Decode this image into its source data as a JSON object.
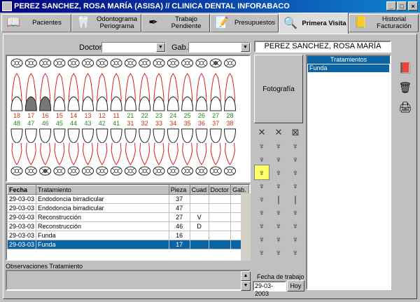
{
  "window": {
    "title": "PEREZ SANCHEZ, ROSA MARÍA (ASISA) // CLINICA DENTAL INFORABACO"
  },
  "tabs": [
    {
      "label": "Pacientes",
      "icon": "book-icon"
    },
    {
      "label": "Odontograma Periograma",
      "icon": "teeth-icon"
    },
    {
      "label": "Trabajo Pendiente",
      "icon": "pen-icon"
    },
    {
      "label": "Presupuestos",
      "icon": "document-pen-icon"
    },
    {
      "label": "Primera Visita",
      "icon": "magnifier-icon",
      "active": true
    },
    {
      "label": "Historial Facturación",
      "icon": "notepad-icon"
    }
  ],
  "filters": {
    "doctor_label": "Doctor",
    "doctor_value": "",
    "gab_label": "Gab.",
    "gab_value": "",
    "patient_name": "PEREZ SANCHEZ, ROSA MARÍA"
  },
  "odontogram": {
    "upper_numbers": [
      "18",
      "17",
      "16",
      "15",
      "14",
      "13",
      "12",
      "11",
      "21",
      "22",
      "23",
      "24",
      "25",
      "26",
      "27",
      "28"
    ],
    "lower_numbers": [
      "48",
      "47",
      "46",
      "45",
      "44",
      "43",
      "42",
      "41",
      "31",
      "32",
      "33",
      "34",
      "35",
      "36",
      "37",
      "38"
    ]
  },
  "photo_button": "Fotografía",
  "treatments_panel": {
    "header": "Tratamientos",
    "items": [
      "Funda"
    ]
  },
  "table": {
    "columns": [
      "Fecha",
      "Tratamiento",
      "Pieza",
      "Cuad",
      "Doctor",
      "Gab."
    ],
    "rows": [
      {
        "fecha": "29-03-03",
        "tratamiento": "Endodoncia birradicular",
        "pieza": "37",
        "cuad": "",
        "doctor": "",
        "gab": ""
      },
      {
        "fecha": "29-03-03",
        "tratamiento": "Endodoncia birradicular",
        "pieza": "47",
        "cuad": "",
        "doctor": "",
        "gab": ""
      },
      {
        "fecha": "29-03-03",
        "tratamiento": "Reconstrucción",
        "pieza": "27",
        "cuad": "V",
        "doctor": "",
        "gab": ""
      },
      {
        "fecha": "29-03-03",
        "tratamiento": "Reconstrucción",
        "pieza": "46",
        "cuad": "D",
        "doctor": "",
        "gab": ""
      },
      {
        "fecha": "29-03-03",
        "tratamiento": "Funda",
        "pieza": "16",
        "cuad": "",
        "doctor": "",
        "gab": ""
      },
      {
        "fecha": "29-03-03",
        "tratamiento": "Funda",
        "pieza": "17",
        "cuad": "",
        "doctor": "",
        "gab": "",
        "selected": true
      }
    ]
  },
  "observations_label": "Observaciones Tratamiento",
  "observations_value": "",
  "work_date": {
    "label": "Fecha de trabajo",
    "value": "29-03-2003",
    "today_button": "Hoy"
  },
  "colors": {
    "title_start": "#000080",
    "selection": "#0a64a4",
    "upper_numbers": "#cc3300",
    "lower_numbers": "#228822"
  }
}
